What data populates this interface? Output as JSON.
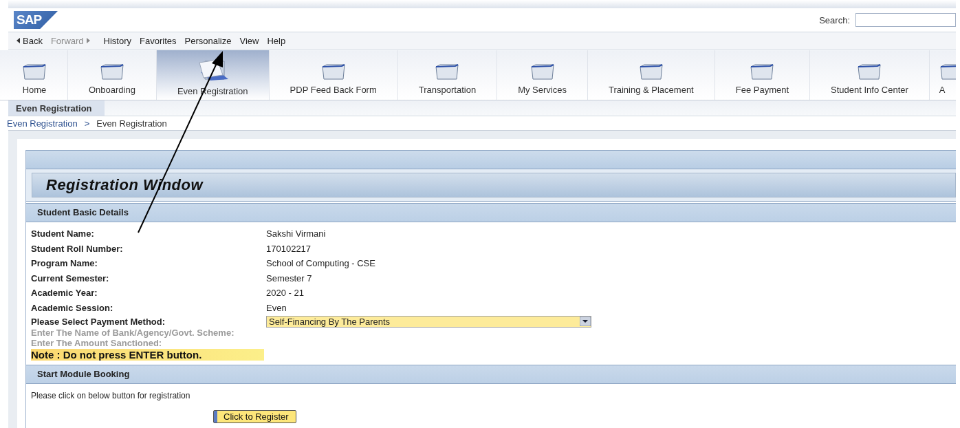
{
  "header": {
    "logo": "SAP",
    "search": {
      "label": "Search:"
    }
  },
  "nav": [
    {
      "label": "Back",
      "kind": "back",
      "disabled": false
    },
    {
      "label": "Forward",
      "kind": "forward",
      "disabled": true
    },
    {
      "label": "History",
      "kind": "menu",
      "disabled": false
    },
    {
      "label": "Favorites",
      "kind": "menu",
      "disabled": false
    },
    {
      "label": "Personalize",
      "kind": "menu",
      "disabled": false
    },
    {
      "label": "View",
      "kind": "menu",
      "disabled": false
    },
    {
      "label": "Help",
      "kind": "menu",
      "disabled": false
    }
  ],
  "tabs": [
    {
      "label": "Home",
      "selected": false
    },
    {
      "label": "Onboarding",
      "selected": false
    },
    {
      "label": "Even Registration",
      "selected": true
    },
    {
      "label": "PDP Feed Back Form",
      "selected": false
    },
    {
      "label": "Transportation",
      "selected": false
    },
    {
      "label": "My Services",
      "selected": false
    },
    {
      "label": "Training & Placement",
      "selected": false
    },
    {
      "label": "Fee Payment",
      "selected": false
    },
    {
      "label": "Student Info Center",
      "selected": false
    },
    {
      "label": "A",
      "selected": false
    }
  ],
  "subtabs": [
    {
      "label": "Even Registration",
      "selected": true
    }
  ],
  "breadcrumb": [
    "Even Registration",
    "Even Registration"
  ],
  "breadcrumb_separator": ">",
  "page": {
    "title": "Registration Window",
    "basic_section": {
      "title": "Student Basic Details",
      "fields": [
        {
          "label": "Student Name:",
          "value": "Sakshi Virmani"
        },
        {
          "label": "Student Roll Number:",
          "value": "170102217"
        },
        {
          "label": "Program Name:",
          "value": "School of Computing - CSE"
        },
        {
          "label": "Current Semester:",
          "value": "Semester 7"
        },
        {
          "label": "Academic Year:",
          "value": "2020 - 21"
        },
        {
          "label": "Academic Session:",
          "value": "Even"
        }
      ],
      "payment": {
        "label": "Please Select Payment Method:",
        "value": "Self-Financing By The Parents"
      },
      "extra_fields": [
        {
          "label": "Enter The Name of Bank/Agency/Govt. Scheme:",
          "disabled": true
        },
        {
          "label": "Enter The Amount Sanctioned:",
          "disabled": true
        }
      ],
      "note": "Note : Do not press ENTER button."
    },
    "booking_section": {
      "title": "Start Module Booking",
      "text": "Please click on below button for registration",
      "button": "Click to Register"
    }
  }
}
